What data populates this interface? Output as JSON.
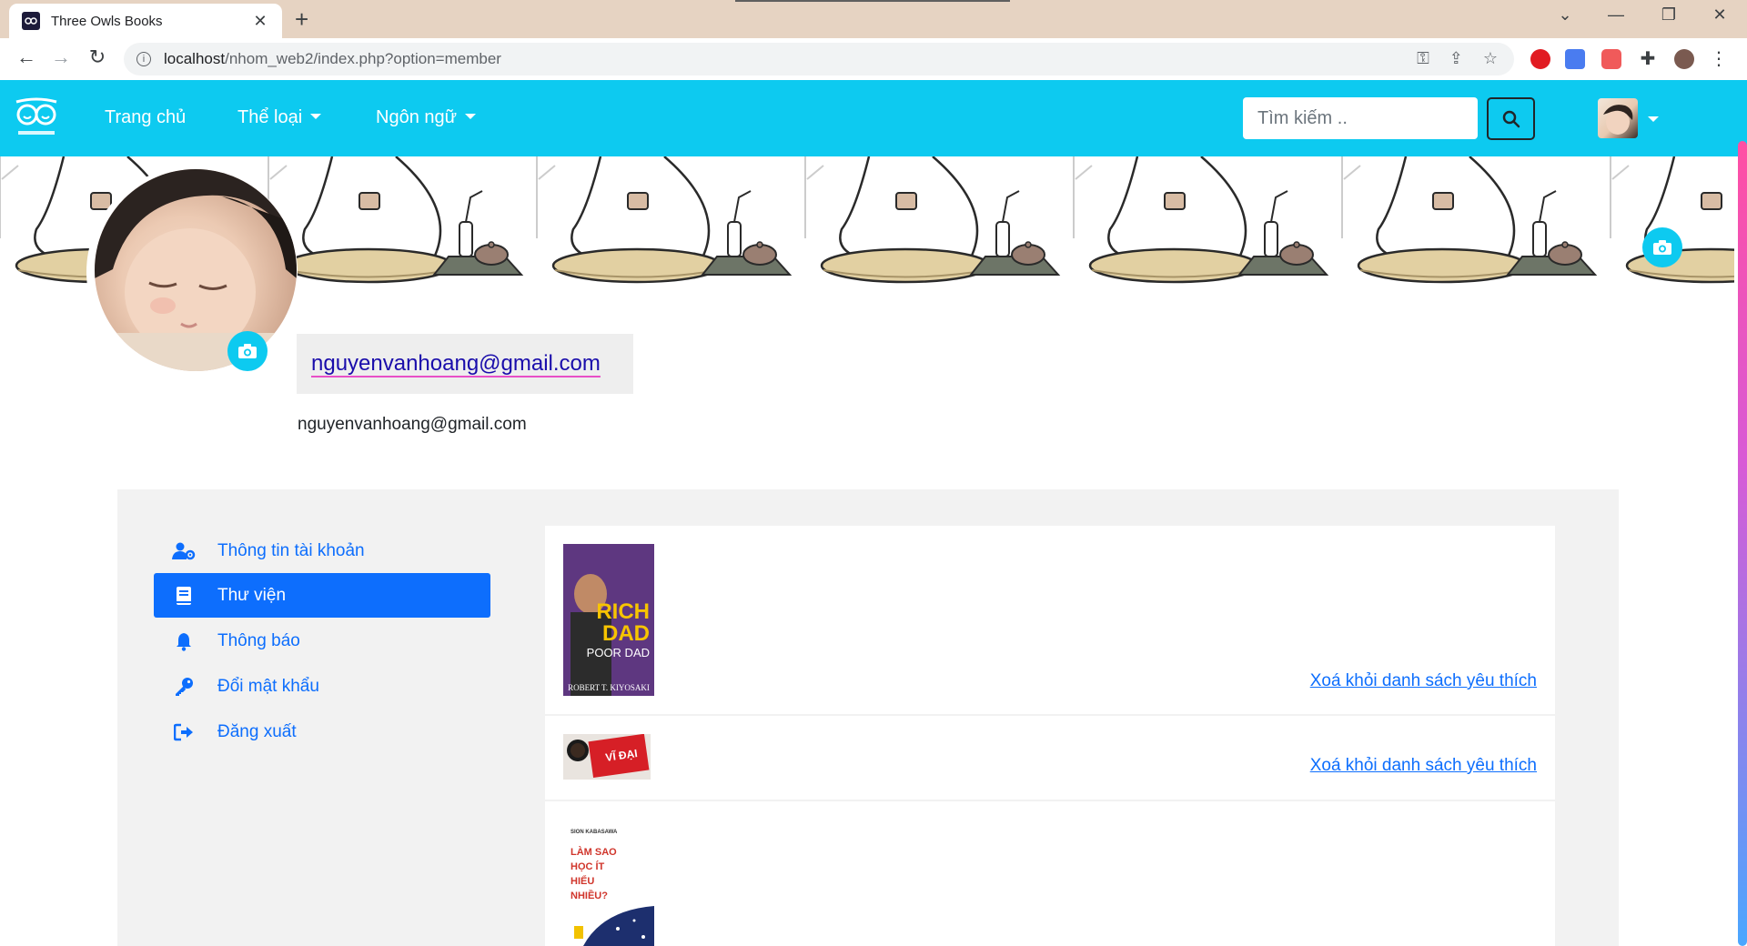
{
  "browser": {
    "tab_title": "Three Owls Books",
    "tab_close": "✕",
    "new_tab": "+",
    "url_host": "localhost",
    "url_path": "/nhom_web2/index.php?option=member"
  },
  "navbar": {
    "links": [
      "Trang chủ",
      "Thể loại",
      "Ngôn ngữ"
    ],
    "search_placeholder": "Tìm kiếm ..",
    "brand_color": "#0dcaf0"
  },
  "profile": {
    "display_name": "nguyenvanhoang@gmail.com",
    "email": "nguyenvanhoang@gmail.com"
  },
  "sidebar": {
    "items": [
      {
        "label": "Thông tin tài khoản",
        "icon": "user-gear-icon"
      },
      {
        "label": "Thư viện",
        "icon": "book-icon",
        "active": true
      },
      {
        "label": "Thông báo",
        "icon": "bell-icon"
      },
      {
        "label": "Đổi mật khẩu",
        "icon": "key-icon"
      },
      {
        "label": "Đăng xuất",
        "icon": "sign-out-icon"
      }
    ]
  },
  "favorites": {
    "remove_label": "Xoá khỏi danh sách yêu thích",
    "books": [
      {
        "cover_lines": [
          "RICH",
          "DAD",
          "POOR DAD",
          "ROBERT T. KIYOSAKI"
        ]
      },
      {
        "cover_lines": [
          "VĨ ĐẠI"
        ]
      },
      {
        "cover_lines": [
          "SION KABASAWA",
          "LÀM SAO",
          "HỌC ÍT",
          "HIỂU",
          "NHIỀU?"
        ]
      }
    ]
  }
}
